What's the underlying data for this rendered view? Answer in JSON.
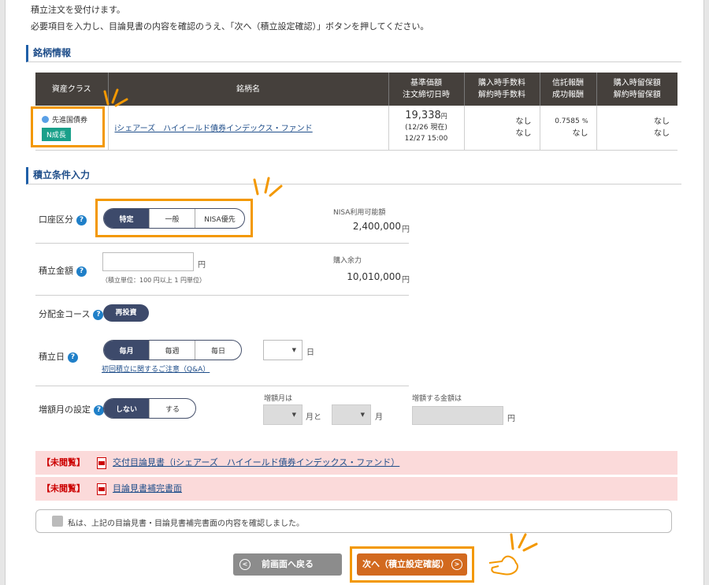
{
  "intro": {
    "line1": "積立注文を受付けます。",
    "line2": "必要項目を入力し、目論見書の内容を確認のうえ、「次へ（積立設定確認）」ボタンを押してください。"
  },
  "fund_section": {
    "title": "銘柄情報",
    "headers": {
      "asset_class": "資産クラス",
      "name": "銘柄名",
      "nav_line1": "基準価額",
      "nav_line2": "注文締切日時",
      "fee_line1": "購入時手数料",
      "fee_line2": "解約時手数料",
      "trust_line1": "信託報酬",
      "trust_line2": "成功報酬",
      "reserve_line1": "購入時留保額",
      "reserve_line2": "解約時留保額"
    },
    "row": {
      "asset_class": "先進国債券",
      "badge": "N成長",
      "fund_name": "iシェアーズ　ハイイールド債券インデックス・ファンド",
      "nav_value": "19,338",
      "nav_unit": "円",
      "nav_date": "(12/26 現在)",
      "deadline": "12/27 15:00",
      "purchase_fee": "なし",
      "redemption_fee": "なし",
      "trust_fee_value": "0.7585",
      "trust_fee_unit": "%",
      "success_fee": "なし",
      "purchase_reserve": "なし",
      "redemption_reserve": "なし"
    }
  },
  "conditions": {
    "title": "積立条件入力",
    "account": {
      "label": "口座区分",
      "options": [
        "特定",
        "一般",
        "NISA優先"
      ],
      "selected": "特定",
      "nisa_label": "NISA利用可能額",
      "nisa_amount": "2,400,000",
      "yen": "円"
    },
    "amount": {
      "label": "積立金額",
      "value": "",
      "yen": "円",
      "note": "（積立単位：100 円以上 1 円単位）",
      "buying_power_label": "購入余力",
      "buying_power": "10,010,000",
      "yen2": "円"
    },
    "distribution": {
      "label": "分配金コース",
      "value": "再投資"
    },
    "schedule": {
      "label": "積立日",
      "options": [
        "毎月",
        "毎週",
        "毎日"
      ],
      "selected": "毎月",
      "day_value": "",
      "day_unit": "日",
      "faq_link": "初回積立に関するご注意（Q&A）"
    },
    "increase": {
      "label": "増額月の設定",
      "options": [
        "しない",
        "する"
      ],
      "selected": "しない",
      "month_label": "増額月は",
      "month_sep1": "月と",
      "month_sep2": "月",
      "amount_label": "増額する金額は",
      "amount_value": "",
      "yen": "円"
    }
  },
  "documents": [
    {
      "tag": "【未閲覧】",
      "text": "交付目論見書（iシェアーズ　ハイイールド債券インデックス・ファンド）"
    },
    {
      "tag": "【未閲覧】",
      "text": "目論見書補完書面"
    }
  ],
  "confirm": {
    "text": "私は、上記の目論見書・目論見書補完書面の内容を確認しました。",
    "checked": false
  },
  "buttons": {
    "back": "前画面へ戻る",
    "next": "次へ（積立設定確認）"
  },
  "colors": {
    "highlight": "#f39800",
    "segment_active": "#3d4a6b",
    "next_button": "#d2691e",
    "back_button": "#8c8c8c",
    "unread_tag": "#cc0000",
    "notice_bg": "#fbdada"
  }
}
